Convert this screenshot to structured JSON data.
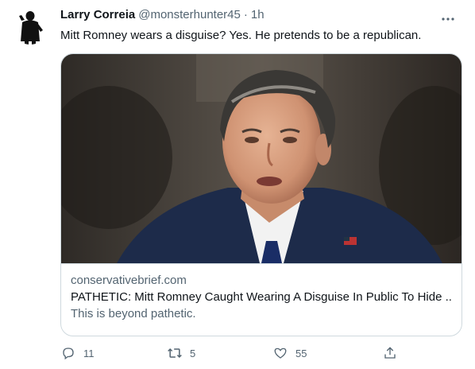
{
  "tweet": {
    "author_name": "Larry Correia",
    "handle": "@monsterhunter45",
    "separator": "·",
    "time": "1h",
    "text": "Mitt Romney wears a disguise? Yes. He pretends to be a republican."
  },
  "card": {
    "domain": "conservativebrief.com",
    "title": "PATHETIC: Mitt Romney Caught Wearing A Disguise In Public To Hide ...",
    "description": "This is beyond pathetic."
  },
  "actions": {
    "reply_count": "11",
    "retweet_count": "5",
    "like_count": "55"
  },
  "icons": {
    "avatar": "silhouette-avatar",
    "more": "more-dots-icon",
    "reply": "reply-icon",
    "retweet": "retweet-icon",
    "like": "heart-icon",
    "share": "share-icon"
  },
  "colors": {
    "text": "#0f1419",
    "secondary": "#536471",
    "border": "#cfd9de"
  }
}
